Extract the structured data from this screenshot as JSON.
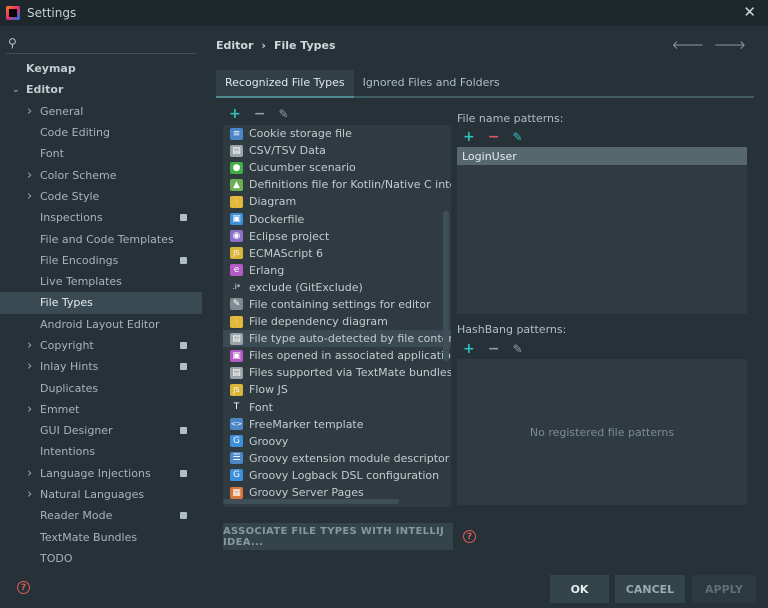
{
  "window": {
    "title": "Settings"
  },
  "sidebar": {
    "search_placeholder": "",
    "items": [
      {
        "label": "Keymap",
        "depth": 0,
        "bold": true,
        "chevron": "",
        "badge": false
      },
      {
        "label": "Editor",
        "depth": 0,
        "bold": true,
        "chevron": "down",
        "badge": false
      },
      {
        "label": "General",
        "depth": 1,
        "chevron": "right",
        "badge": false
      },
      {
        "label": "Code Editing",
        "depth": 1,
        "chevron": "",
        "badge": false
      },
      {
        "label": "Font",
        "depth": 1,
        "chevron": "",
        "badge": false
      },
      {
        "label": "Color Scheme",
        "depth": 1,
        "chevron": "right",
        "badge": false
      },
      {
        "label": "Code Style",
        "depth": 1,
        "chevron": "right",
        "badge": false
      },
      {
        "label": "Inspections",
        "depth": 1,
        "chevron": "",
        "badge": true
      },
      {
        "label": "File and Code Templates",
        "depth": 1,
        "chevron": "",
        "badge": false
      },
      {
        "label": "File Encodings",
        "depth": 1,
        "chevron": "",
        "badge": true
      },
      {
        "label": "Live Templates",
        "depth": 1,
        "chevron": "",
        "badge": false
      },
      {
        "label": "File Types",
        "depth": 1,
        "chevron": "",
        "badge": false,
        "selected": true
      },
      {
        "label": "Android Layout Editor",
        "depth": 1,
        "chevron": "",
        "badge": false
      },
      {
        "label": "Copyright",
        "depth": 1,
        "chevron": "right",
        "badge": true
      },
      {
        "label": "Inlay Hints",
        "depth": 1,
        "chevron": "right",
        "badge": true
      },
      {
        "label": "Duplicates",
        "depth": 1,
        "chevron": "",
        "badge": false
      },
      {
        "label": "Emmet",
        "depth": 1,
        "chevron": "right",
        "badge": false
      },
      {
        "label": "GUI Designer",
        "depth": 1,
        "chevron": "",
        "badge": true
      },
      {
        "label": "Intentions",
        "depth": 1,
        "chevron": "",
        "badge": false
      },
      {
        "label": "Language Injections",
        "depth": 1,
        "chevron": "right",
        "badge": true
      },
      {
        "label": "Natural Languages",
        "depth": 1,
        "chevron": "right",
        "badge": false
      },
      {
        "label": "Reader Mode",
        "depth": 1,
        "chevron": "",
        "badge": true
      },
      {
        "label": "TextMate Bundles",
        "depth": 1,
        "chevron": "",
        "badge": false
      },
      {
        "label": "TODO",
        "depth": 1,
        "chevron": "",
        "badge": false
      }
    ]
  },
  "breadcrumb": {
    "parent": "Editor",
    "sep": "›",
    "current": "File Types"
  },
  "tabs": [
    {
      "label": "Recognized File Types",
      "active": true
    },
    {
      "label": "Ignored Files and Folders",
      "active": false
    }
  ],
  "file_types": [
    {
      "label": "Cookie storage file",
      "icon": "cookie-icon",
      "color": "#4a86c8",
      "glyph": "≡"
    },
    {
      "label": "CSV/TSV Data",
      "icon": "document-icon",
      "color": "#9aa4a8",
      "glyph": "▤"
    },
    {
      "label": "Cucumber scenario",
      "icon": "cucumber-icon",
      "color": "#3fae44",
      "glyph": "●"
    },
    {
      "label": "Definitions file for Kotlin/Native C interope",
      "icon": "android-icon",
      "color": "#6cae55",
      "glyph": "▲"
    },
    {
      "label": "Diagram",
      "icon": "diagram-icon",
      "color": "#e2b93b",
      "glyph": "⫶"
    },
    {
      "label": "Dockerfile",
      "icon": "docker-icon",
      "color": "#3c8fd9",
      "glyph": "▣"
    },
    {
      "label": "Eclipse project",
      "icon": "eclipse-icon",
      "color": "#8b6fc9",
      "glyph": "◉"
    },
    {
      "label": "ECMAScript 6",
      "icon": "js-icon",
      "color": "#d9b53a",
      "glyph": "JS"
    },
    {
      "label": "Erlang",
      "icon": "erlang-icon",
      "color": "#b35ac4",
      "glyph": "e"
    },
    {
      "label": "exclude (GitExclude)",
      "icon": "git-icon",
      "color": "#2f3b41",
      "glyph": ".i*"
    },
    {
      "label": "File containing settings for editor",
      "icon": "editorconfig-icon",
      "color": "#7d8a90",
      "glyph": "✎"
    },
    {
      "label": "File dependency diagram",
      "icon": "dependency-diagram-icon",
      "color": "#e2b93b",
      "glyph": "⫶"
    },
    {
      "label": "File type auto-detected by file content",
      "icon": "document-icon",
      "color": "#9aa4a8",
      "glyph": "▤",
      "selected": true
    },
    {
      "label": "Files opened in associated applications",
      "icon": "external-app-icon",
      "color": "#b35ac4",
      "glyph": "▣"
    },
    {
      "label": "Files supported via TextMate bundles",
      "icon": "document-icon",
      "color": "#9aa4a8",
      "glyph": "▤"
    },
    {
      "label": "Flow JS",
      "icon": "js-icon",
      "color": "#d9b53a",
      "glyph": "JS"
    },
    {
      "label": "Font",
      "icon": "font-icon",
      "color": "#2f3b41",
      "glyph": "T"
    },
    {
      "label": "FreeMarker template",
      "icon": "freemarker-icon",
      "color": "#4a86c8",
      "glyph": "<>"
    },
    {
      "label": "Groovy",
      "icon": "groovy-icon",
      "color": "#3c8fd9",
      "glyph": "G"
    },
    {
      "label": "Groovy extension module descriptor file",
      "icon": "settings-file-icon",
      "color": "#4a86c8",
      "glyph": "☰"
    },
    {
      "label": "Groovy Logback DSL configuration",
      "icon": "groovy-icon",
      "color": "#3c8fd9",
      "glyph": "G"
    },
    {
      "label": "Groovy Server Pages",
      "icon": "gsp-icon",
      "color": "#d8763a",
      "glyph": "▦"
    }
  ],
  "file_name_patterns": {
    "label": "File name patterns:",
    "items": [
      "LoginUser"
    ]
  },
  "hashbang_patterns": {
    "label": "HashBang patterns:",
    "empty_text": "No registered file patterns"
  },
  "associate_button": "ASSOCIATE FILE TYPES WITH INTELLIJ IDEA...",
  "footer": {
    "ok": "OK",
    "cancel": "CANCEL",
    "apply": "APPLY"
  },
  "colors": {
    "background": "#263238",
    "selection": "#3a4a52",
    "add": "#2fbfbf",
    "remove": "#e05a5a"
  }
}
